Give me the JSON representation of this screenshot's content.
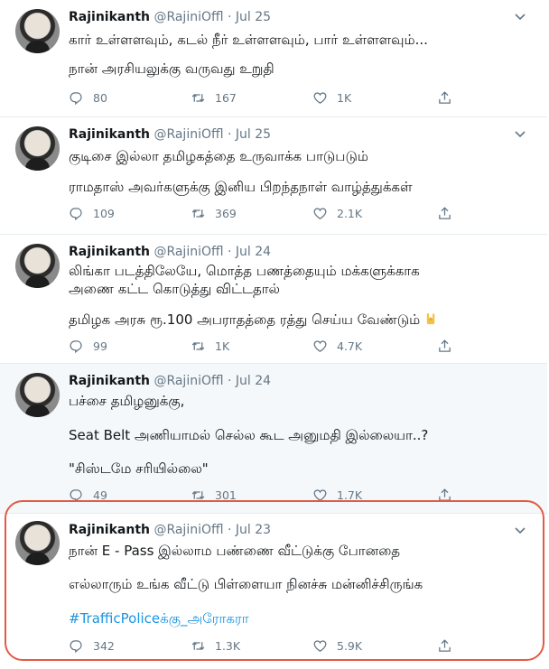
{
  "author": {
    "name": "Rajinikanth",
    "handle": "@RajiniOffl",
    "separator": "·"
  },
  "tweets": [
    {
      "date": "Jul 25",
      "lines": [
        "கார் உள்ளளவும், கடல் நீர் உள்ளளவும், பார் உள்ளளவும்...",
        "நான் அரசியலுக்கு வருவது உறுதி"
      ],
      "replies": "80",
      "retweets": "167",
      "likes": "1K"
    },
    {
      "date": "Jul 25",
      "lines": [
        "குடிசை இல்லா தமிழகத்தை உருவாக்க பாடுபடும்",
        "ராமதாஸ் அவர்களுக்கு இனிய பிறந்தநாள் வாழ்த்துக்கள்"
      ],
      "replies": "109",
      "retweets": "369",
      "likes": "2.1K"
    },
    {
      "date": "Jul 24",
      "lines": [
        "லிங்கா படத்திலேயே, மொத்த பணத்தையும் மக்களுக்காக",
        "அணை கட்ட கொடுத்து விட்டதால்",
        "தமிழக அரசு ரூ.100 அபராதத்தை ரத்து செய்ய வேண்டும்"
      ],
      "replies": "99",
      "retweets": "1K",
      "likes": "4.7K"
    },
    {
      "date": "Jul 24",
      "lines": [
        "பச்சை தமிழனுக்கு,",
        "Seat Belt அணியாமல் செல்ல கூட அனுமதி இல்லையா..?",
        "\"சிஸ்டமே சரியில்லை\""
      ],
      "replies": "49",
      "retweets": "301",
      "likes": "1.7K"
    },
    {
      "date": "Jul 23",
      "lines": [
        "நான் E - Pass இல்லாம பண்ணை வீட்டுக்கு போனதை",
        "எல்லாரும் உங்க வீட்டு பிள்ளையா நினச்சு மன்னிச்சிருங்க"
      ],
      "hashtag": "#TrafficPoliceக்கு_அரோகரா",
      "replies": "342",
      "retweets": "1.3K",
      "likes": "5.9K"
    }
  ],
  "colors": {
    "accent": "#1b95e0",
    "muted": "#657786",
    "highlight_ring": "#e25b45",
    "highlight_bg": "#f5f8fa"
  },
  "icons": [
    "reply-icon",
    "retweet-icon",
    "like-icon",
    "share-icon",
    "chevron-down-icon",
    "rock-hand-emoji"
  ]
}
